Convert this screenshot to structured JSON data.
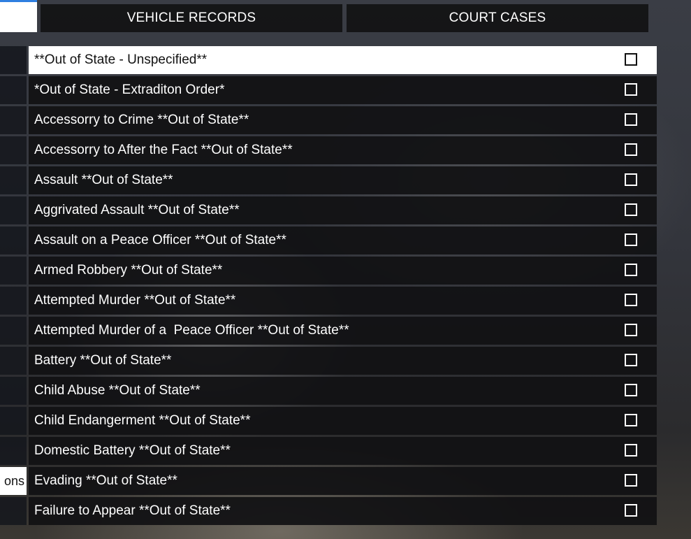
{
  "tabs": {
    "vehicle_records": "VEHICLE RECORDS",
    "court_cases": "COURT CASES"
  },
  "side_panel": {
    "visible_text": "ons"
  },
  "charges": [
    {
      "label": "**Out of State - Unspecified**",
      "checked": false,
      "selected": true
    },
    {
      "label": "*Out of State - Extraditon Order*",
      "checked": false
    },
    {
      "label": "Accessorry to Crime **Out of State**",
      "checked": false
    },
    {
      "label": "Accessorry to After the Fact **Out of State**",
      "checked": false
    },
    {
      "label": "Assault **Out of State**",
      "checked": false
    },
    {
      "label": "Aggrivated Assault **Out of State**",
      "checked": false
    },
    {
      "label": "Assault on a Peace Officer **Out of State**",
      "checked": false
    },
    {
      "label": "Armed Robbery **Out of State**",
      "checked": false
    },
    {
      "label": "Attempted Murder **Out of State**",
      "checked": false
    },
    {
      "label": "Attempted Murder of a  Peace Officer **Out of State**",
      "checked": false
    },
    {
      "label": "Battery **Out of State**",
      "checked": false
    },
    {
      "label": "Child Abuse **Out of State**",
      "checked": false
    },
    {
      "label": "Child Endangerment **Out of State**",
      "checked": false
    },
    {
      "label": "Domestic Battery **Out of State**",
      "checked": false
    },
    {
      "label": "Evading **Out of State**",
      "checked": false
    },
    {
      "label": "Failure to Appear **Out of State**",
      "checked": false
    }
  ]
}
